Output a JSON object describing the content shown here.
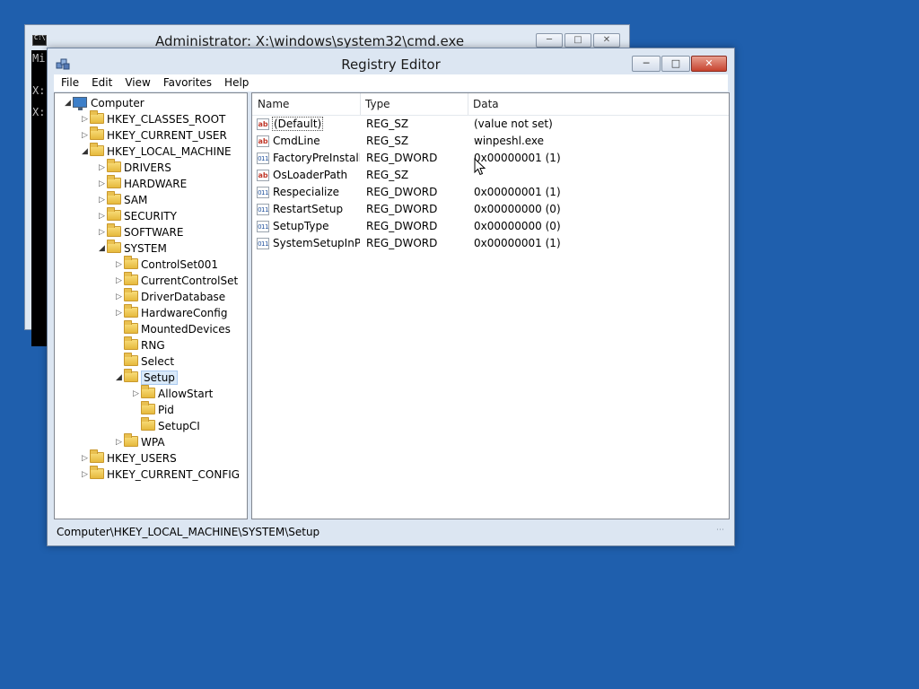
{
  "cmd_window": {
    "title": "Administrator: X:\\windows\\system32\\cmd.exe",
    "icon": "cmd-icon",
    "lines": [
      "Mi",
      "X:",
      "X:"
    ]
  },
  "regedit": {
    "title": "Registry Editor",
    "icon": "regedit-icon",
    "menu": [
      "File",
      "Edit",
      "View",
      "Favorites",
      "Help"
    ],
    "tree": [
      {
        "label": "Computer",
        "level": 0,
        "expanded": true,
        "icon": "computer-icon"
      },
      {
        "label": "HKEY_CLASSES_ROOT",
        "level": 1,
        "expanded": false
      },
      {
        "label": "HKEY_CURRENT_USER",
        "level": 1,
        "expanded": false
      },
      {
        "label": "HKEY_LOCAL_MACHINE",
        "level": 1,
        "expanded": true
      },
      {
        "label": "DRIVERS",
        "level": 2,
        "expanded": false
      },
      {
        "label": "HARDWARE",
        "level": 2,
        "expanded": false
      },
      {
        "label": "SAM",
        "level": 2,
        "expanded": false
      },
      {
        "label": "SECURITY",
        "level": 2,
        "expanded": false
      },
      {
        "label": "SOFTWARE",
        "level": 2,
        "expanded": false
      },
      {
        "label": "SYSTEM",
        "level": 2,
        "expanded": true
      },
      {
        "label": "ControlSet001",
        "level": 3,
        "expanded": false
      },
      {
        "label": "CurrentControlSet",
        "level": 3,
        "expanded": false
      },
      {
        "label": "DriverDatabase",
        "level": 3,
        "expanded": false
      },
      {
        "label": "HardwareConfig",
        "level": 3,
        "expanded": false
      },
      {
        "label": "MountedDevices",
        "level": 3,
        "leaf": true
      },
      {
        "label": "RNG",
        "level": 3,
        "leaf": true
      },
      {
        "label": "Select",
        "level": 3,
        "leaf": true
      },
      {
        "label": "Setup",
        "level": 3,
        "expanded": true,
        "selected": true
      },
      {
        "label": "AllowStart",
        "level": 4,
        "expanded": false
      },
      {
        "label": "Pid",
        "level": 4,
        "leaf": true
      },
      {
        "label": "SetupCI",
        "level": 4,
        "leaf": true
      },
      {
        "label": "WPA",
        "level": 3,
        "expanded": false
      },
      {
        "label": "HKEY_USERS",
        "level": 1,
        "expanded": false
      },
      {
        "label": "HKEY_CURRENT_CONFIG",
        "level": 1,
        "expanded": false
      }
    ],
    "columns": {
      "name": "Name",
      "type": "Type",
      "data": "Data"
    },
    "values": [
      {
        "name": "(Default)",
        "type": "REG_SZ",
        "data": "(value not set)",
        "kind": "sz",
        "selected": true
      },
      {
        "name": "CmdLine",
        "type": "REG_SZ",
        "data": "winpeshl.exe",
        "kind": "sz"
      },
      {
        "name": "FactoryPreInstall...",
        "type": "REG_DWORD",
        "data": "0x00000001 (1)",
        "kind": "dw"
      },
      {
        "name": "OsLoaderPath",
        "type": "REG_SZ",
        "data": "",
        "kind": "sz"
      },
      {
        "name": "Respecialize",
        "type": "REG_DWORD",
        "data": "0x00000001 (1)",
        "kind": "dw"
      },
      {
        "name": "RestartSetup",
        "type": "REG_DWORD",
        "data": "0x00000000 (0)",
        "kind": "dw"
      },
      {
        "name": "SetupType",
        "type": "REG_DWORD",
        "data": "0x00000000 (0)",
        "kind": "dw"
      },
      {
        "name": "SystemSetupInP...",
        "type": "REG_DWORD",
        "data": "0x00000001 (1)",
        "kind": "dw"
      }
    ],
    "status_path": "Computer\\HKEY_LOCAL_MACHINE\\SYSTEM\\Setup"
  },
  "colors": {
    "desktop": "#1f5fad",
    "window_frame": "#dce6f2",
    "close_button": "#c7432e",
    "selection": "#d9e9f9"
  }
}
